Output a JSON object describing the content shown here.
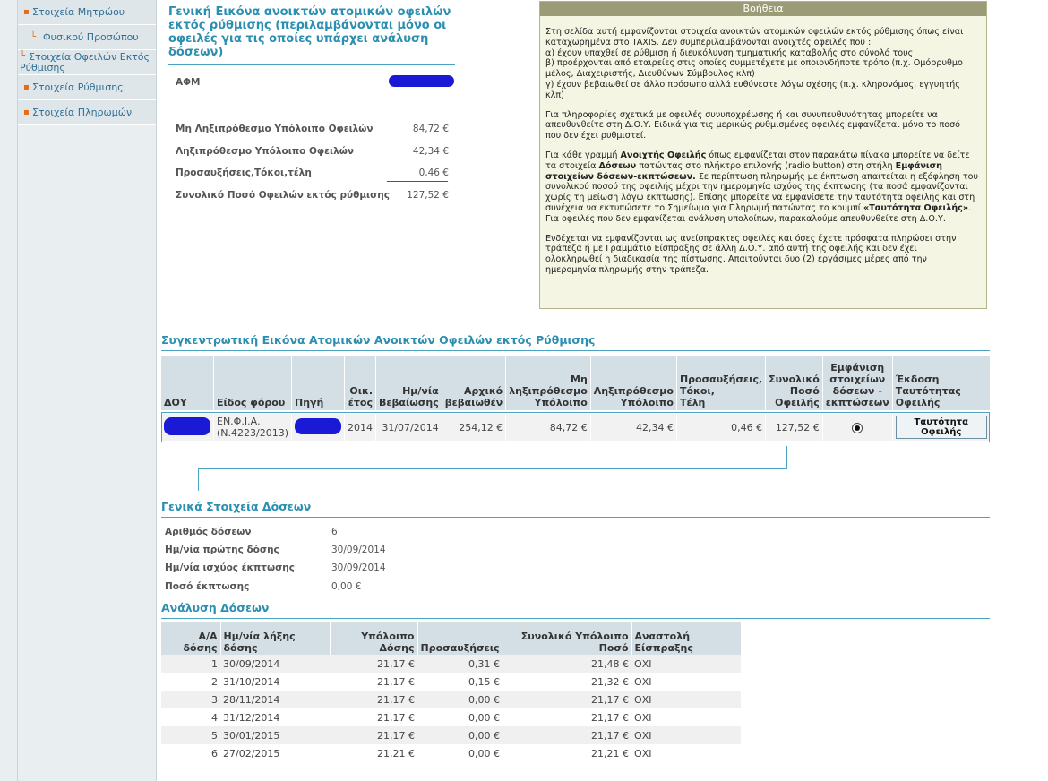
{
  "sidebar": {
    "items": [
      {
        "label": "Στοιχεία Μητρώου"
      },
      {
        "label": "Φυσικού Προσώπου"
      },
      {
        "label_line1": "Στοιχεία Οφειλών Εκτός",
        "label_line2": "Ρύθμισης"
      },
      {
        "label": "Στοιχεία Ρύθμισης"
      },
      {
        "label": "Στοιχεία Πληρωμών"
      }
    ]
  },
  "overview": {
    "title": "Γενική Εικόνα ανοικτών ατομικών οφειλών εκτός ρύθμισης (περιλαμβάνονται μόνο οι οφειλές για τις οποίες υπάρχει ανάλυση δόσεων)",
    "afm_label": "ΑΦΜ",
    "rows": [
      {
        "label": "Μη Ληξιπρόθεσμο Υπόλοιπο Οφειλών",
        "value": "84,72 €"
      },
      {
        "label": "Ληξιπρόθεσμο Υπόλοιπο Οφειλών",
        "value": "42,34 €"
      },
      {
        "label": "Προσαυξήσεις,Τόκοι,τέλη",
        "value": "0,46 €"
      },
      {
        "label": "Συνολικό Ποσό Οφειλών εκτός ρύθμισης",
        "value": "127,52 €"
      }
    ]
  },
  "help": {
    "title": "Βοήθεια",
    "p1_lines": [
      "Στη σελίδα αυτή εμφανίζονται στοιχεία ανοικτών ατομικών οφειλών εκτός ρύθμισης όπως είναι",
      "καταχωρημένα στο TAXIS. Δεν συμπεριλαμβάνονται ανοιχτές οφειλές που :",
      "α) έχουν υπαχθεί σε ρύθμιση ή διευκόλυνση τμηματικής καταβολής στο σύνολό τους",
      "β) προέρχονται από εταιρείες στις οποίες συμμετέχετε με οποιονδήποτε τρόπο (π.χ. Ομόρρυθμο",
      "μέλος, Διαχειριστής, Διευθύνων Σύμβουλος κλπ)",
      "γ) έχουν βεβαιωθεί σε άλλο πρόσωπο αλλά ευθύνεστε λόγω σχέσης (π.χ. κληρονόμος, εγγυητής",
      "κλπ)"
    ],
    "p2_lines": [
      "Για πληροφορίες σχετικά με οφειλές συνυποχρέωσης ή και συνυπευθυνότητας μπορείτε να",
      "απευθυνθείτε στη Δ.Ο.Υ. Ειδικά για τις μερικώς ρυθμισμένες οφειλές εμφανίζεται μόνο το ποσό",
      "που δεν έχει ρυθμιστεί."
    ],
    "p3": {
      "t1": "Για κάθε γραμμή ",
      "b1": "Ανοιχτής Οφειλής",
      "t2": " όπως εμφανίζεται στον παρακάτω πίνακα μπορείτε να δείτε τα στοιχεία ",
      "b2": "Δόσεων",
      "t3": " πατώντας στο πλήκτρο επιλογής (radio button) στη στήλη ",
      "b3": "Εμφάνιση στοιχείων δόσεων-εκπτώσεων.",
      "t4": " Σε περίπτωση πληρωμής με έκπτωση απαιτείται η εξόφληση του συνολικού ποσού της οφειλής μέχρι την ημερομηνία ισχύος της έκπτωσης (τα ποσά εμφανίζονται χωρίς τη μείωση λόγω έκπτωσης). Επίσης μπορείτε να εμφανίσετε την ταυτότητα οφειλής και στη συνέχεια να εκτυπώσετε το Σημείωμα για Πληρωμή πατώντας το κουμπί ",
      "b4": "«Ταυτότητα Οφειλής»",
      "t5": ". Για οφειλές που δεν εμφανίζεται ανάλυση υπολοίπων, παρακαλούμε απευθυνθείτε στη Δ.Ο.Υ."
    },
    "p4_lines": [
      "Ενδέχεται να εμφανίζονται ως ανείσπρακτες οφειλές και όσες έχετε πρόσφατα πληρώσει στην",
      "τράπεζα ή με Γραμμάτιο Είσπραξης σε άλλη Δ.Ο.Υ. από αυτή της οφειλής και δεν έχει",
      "ολοκληρωθεί η διαδικασία της πίστωσης. Απαιτούνται δυο (2) εργάσιμες μέρες από την",
      "ημερομηνία πληρωμής στην τράπεζα."
    ]
  },
  "debts": {
    "title": "Συγκεντρωτική Εικόνα Ατομικών Ανοικτών Οφειλών εκτός Ρύθμισης",
    "headers": {
      "doy": "ΔΟΥ",
      "tax_type": "Είδος φόρου",
      "source": "Πηγή",
      "year": [
        "Οικ.",
        "έτος"
      ],
      "date": [
        "Ημ/νία",
        "Βεβαίωσης"
      ],
      "initial": [
        "Αρχικό",
        "βεβαιωθέν"
      ],
      "not_overdue": [
        "Μη",
        "ληξιπρόθεσμο",
        "Υπόλοιπο"
      ],
      "overdue": [
        "Ληξιπρόθεσμο",
        "Υπόλοιπο"
      ],
      "surcharges": [
        "Προσαυξήσεις,",
        "Τόκοι,",
        "Τέλη"
      ],
      "total": [
        "Συνολικό",
        "Ποσό",
        "Οφειλής"
      ],
      "show": [
        "Εμφάνιση",
        "στοιχείων",
        "δόσεων -",
        "εκπτώσεων"
      ],
      "issue": [
        "Έκδοση",
        "Ταυτότητας",
        "Οφειλής"
      ]
    },
    "row": {
      "tax_type_line1": "ΕΝ.Φ.Ι.Α.",
      "tax_type_line2": "(Ν.4223/2013)",
      "year": "2014",
      "date": "31/07/2014",
      "initial": "254,12 €",
      "not_overdue": "84,72 €",
      "overdue": "42,34 €",
      "surcharges": "0,46 €",
      "total": "127,52 €",
      "button_line1": "Ταυτότητα",
      "button_line2": "Οφειλής"
    }
  },
  "installments": {
    "title": "Γενικά Στοιχεία Δόσεων",
    "rows": [
      {
        "label": "Αριθμός δόσεων",
        "value": "6"
      },
      {
        "label": "Ημ/νία πρώτης δόσης",
        "value": "30/09/2014"
      },
      {
        "label": "Ημ/νία ισχύος έκπτωσης",
        "value": "30/09/2014"
      },
      {
        "label": "Ποσό έκπτωσης",
        "value": "0,00 €"
      }
    ]
  },
  "analysis": {
    "title": "Ανάλυση Δόσεων",
    "headers": {
      "aa": [
        "Α/Α",
        "δόσης"
      ],
      "due": [
        "Ημ/νία λήξης",
        "δόσης"
      ],
      "balance": [
        "Υπόλοιπο",
        "Δόσης"
      ],
      "surcharges": [
        "Προσαυξήσεις"
      ],
      "total": [
        "Συνολικό Υπόλοιπο",
        "Ποσό"
      ],
      "suspend": [
        "Αναστολή",
        "Είσπραξης"
      ]
    },
    "rows": [
      {
        "aa": "1",
        "due": "30/09/2014",
        "balance": "21,17 €",
        "surcharges": "0,31 €",
        "total": "21,48 €",
        "suspend": "ΟΧΙ"
      },
      {
        "aa": "2",
        "due": "31/10/2014",
        "balance": "21,17 €",
        "surcharges": "0,15 €",
        "total": "21,32 €",
        "suspend": "ΟΧΙ"
      },
      {
        "aa": "3",
        "due": "28/11/2014",
        "balance": "21,17 €",
        "surcharges": "0,00 €",
        "total": "21,17 €",
        "suspend": "ΟΧΙ"
      },
      {
        "aa": "4",
        "due": "31/12/2014",
        "balance": "21,17 €",
        "surcharges": "0,00 €",
        "total": "21,17 €",
        "suspend": "ΟΧΙ"
      },
      {
        "aa": "5",
        "due": "30/01/2015",
        "balance": "21,17 €",
        "surcharges": "0,00 €",
        "total": "21,17 €",
        "suspend": "ΟΧΙ"
      },
      {
        "aa": "6",
        "due": "27/02/2015",
        "balance": "21,21 €",
        "surcharges": "0,00 €",
        "total": "21,21 €",
        "suspend": "ΟΧΙ"
      }
    ]
  },
  "colors": {
    "accent": "#2a8fb0",
    "redaction": "#1a1ad6",
    "help_bg": "#f4f6e3",
    "help_header": "#9b9b78",
    "table_header": "#d3dfe5",
    "bullet": "#e36b1b"
  }
}
